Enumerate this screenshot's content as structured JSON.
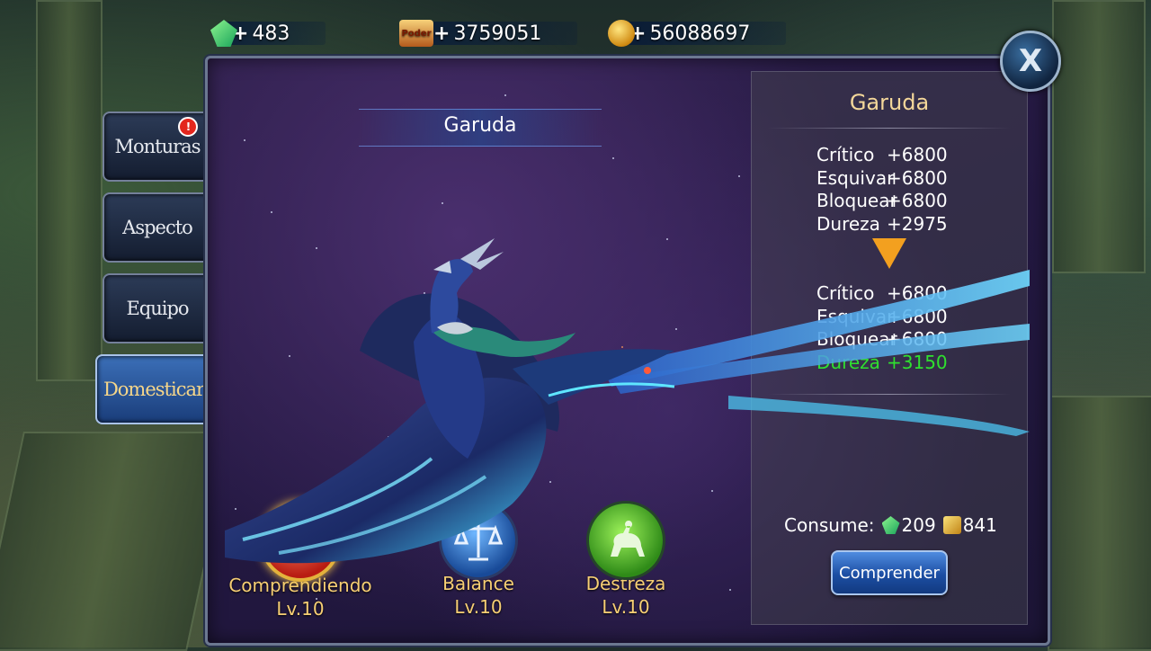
{
  "currencies": [
    {
      "icon": "gem-icon",
      "value": "483"
    },
    {
      "icon": "power-icon",
      "label": "Poder",
      "value": "3759051"
    },
    {
      "icon": "gold-coin-icon",
      "value": "56088697"
    }
  ],
  "close_label": "X",
  "tabs": [
    {
      "label": "Monturas",
      "badge": "!"
    },
    {
      "label": "Aspecto"
    },
    {
      "label": "Equipo"
    },
    {
      "label": "Domesticar"
    }
  ],
  "mount": {
    "name": "Garuda"
  },
  "stats_panel": {
    "title": "Garuda",
    "current": [
      {
        "name": "Crítico",
        "value": "+6800"
      },
      {
        "name": "Esquivar",
        "value": "+6800"
      },
      {
        "name": "Bloquear",
        "value": "+6800"
      },
      {
        "name": "Dureza",
        "value": "+2975"
      }
    ],
    "next": [
      {
        "name": "Crítico",
        "value": "+6800"
      },
      {
        "name": "Esquivar",
        "value": "+6800"
      },
      {
        "name": "Bloquear",
        "value": "+6800"
      },
      {
        "name": "Dureza",
        "value": "+3150"
      }
    ],
    "consume_label": "Consume:",
    "consume_gems": "209",
    "consume_gold": "841",
    "button_label": "Comprender",
    "highlight_color": "#2fe02f"
  },
  "skills": [
    {
      "name": "Comprendiendo",
      "level": "Lv.10",
      "icon": "heart-icon"
    },
    {
      "name": "Balance",
      "level": "Lv.10",
      "icon": "scales-icon"
    },
    {
      "name": "Destreza",
      "level": "Lv.10",
      "icon": "horse-rider-icon"
    }
  ]
}
